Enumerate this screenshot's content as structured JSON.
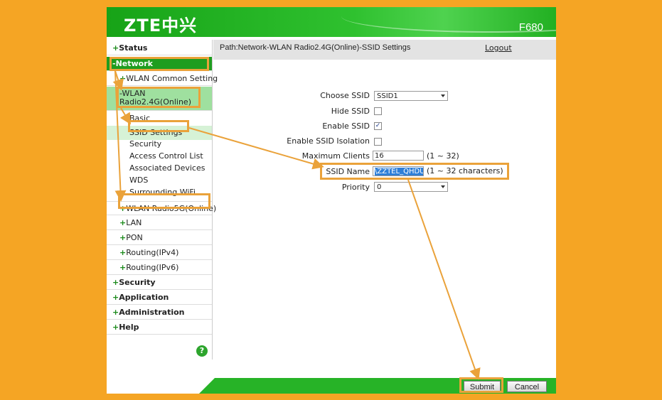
{
  "header": {
    "logo": "ZTE中兴",
    "model": "F680"
  },
  "path": {
    "text": "Path:Network-WLAN Radio2.4G(Online)-SSID Settings",
    "logout": "Logout"
  },
  "sidebar": {
    "status": "Status",
    "network": "-Network",
    "wlan_common": "WLAN Common Setting",
    "wlan24_line1": "-WLAN",
    "wlan24_line2": "Radio2.4G(Online)",
    "basic": "Basic",
    "ssid_settings": "SSID Settings",
    "security_leaf": "Security",
    "acl": "Access Control List",
    "associated": "Associated Devices",
    "wds": "WDS",
    "surrounding": "Surrounding WiFi",
    "wlan5g": "WLAN Radio5G(Online)",
    "lan": "LAN",
    "pon": "PON",
    "routing4": "Routing(IPv4)",
    "routing6": "Routing(IPv6)",
    "security": "Security",
    "application": "Application",
    "administration": "Administration",
    "help": "Help",
    "plus": "+",
    "help_icon": "?"
  },
  "form": {
    "choose_ssid_label": "Choose SSID",
    "choose_ssid_value": "SSID1",
    "hide_ssid_label": "Hide SSID",
    "enable_ssid_label": "Enable SSID",
    "enable_ssid_check": "✓",
    "isolation_label": "Enable SSID Isolation",
    "max_clients_label": "Maximum Clients",
    "max_clients_value": "16",
    "max_clients_hint": "(1 ~ 32)",
    "ssid_name_label": "SSID Name",
    "ssid_name_value": "\\ZZTEL_QHDU",
    "ssid_name_hint": "(1 ~ 32 characters)",
    "priority_label": "Priority",
    "priority_value": "0"
  },
  "buttons": {
    "submit": "Submit",
    "cancel": "Cancel"
  },
  "colors": {
    "background": "#f5a524",
    "zte_green": "#27b327",
    "highlight": "#eaa23a",
    "selection": "#2f7fd8"
  }
}
